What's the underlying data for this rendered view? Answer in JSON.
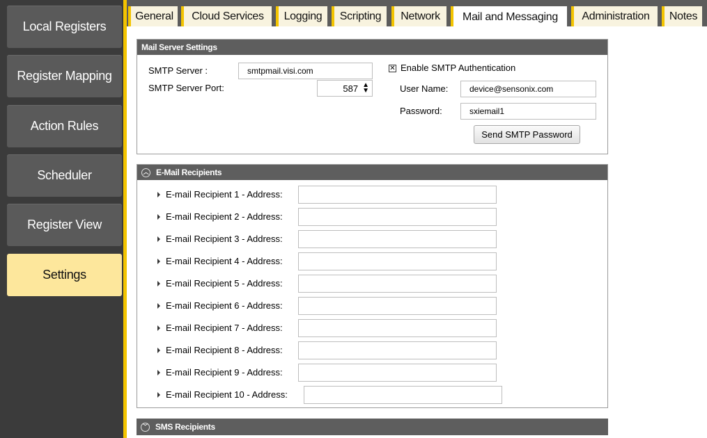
{
  "sidebar": {
    "items": [
      {
        "label": "Local Registers",
        "active": false
      },
      {
        "label": "Register Mapping",
        "active": false
      },
      {
        "label": "Action Rules",
        "active": false
      },
      {
        "label": "Scheduler",
        "active": false
      },
      {
        "label": "Register View",
        "active": false
      },
      {
        "label": "Settings",
        "active": true
      }
    ]
  },
  "tabs": [
    {
      "label": "General"
    },
    {
      "label": "Cloud Services"
    },
    {
      "label": "Logging"
    },
    {
      "label": "Scripting"
    },
    {
      "label": "Network"
    },
    {
      "label": "Mail and Messaging",
      "active": true
    },
    {
      "label": "Administration"
    },
    {
      "label": "Notes"
    }
  ],
  "mail_server": {
    "title": "Mail Server Settings",
    "smtp_server_label": "SMTP Server :",
    "smtp_server_value": "smtpmail.visi.com",
    "smtp_port_label": "SMTP Server Port:",
    "smtp_port_value": "587",
    "enable_auth_label": "Enable SMTP Authentication",
    "enable_auth_checked": "✕",
    "username_label": "User Name:",
    "username_value": "device@sensonix.com",
    "password_label": "Password:",
    "password_value": "sxiemail1",
    "send_button": "Send SMTP Password"
  },
  "email_recipients": {
    "title": "E-Mail Recipients",
    "items": [
      {
        "label": "E-mail Recipient 1  -  Address:",
        "value": ""
      },
      {
        "label": "E-mail Recipient 2  -  Address:",
        "value": ""
      },
      {
        "label": "E-mail Recipient 3  -  Address:",
        "value": ""
      },
      {
        "label": "E-mail Recipient 4  -  Address:",
        "value": ""
      },
      {
        "label": "E-mail Recipient 5  -  Address:",
        "value": ""
      },
      {
        "label": "E-mail Recipient 6  -  Address:",
        "value": ""
      },
      {
        "label": "E-mail Recipient 7  -  Address:",
        "value": ""
      },
      {
        "label": "E-mail Recipient 8  -  Address:",
        "value": ""
      },
      {
        "label": "E-mail Recipient 9  -  Address:",
        "value": ""
      },
      {
        "label": "E-mail Recipient 10  -  Address:",
        "value": ""
      }
    ]
  },
  "sms_recipients": {
    "title": "SMS Recipients"
  },
  "colors": {
    "sidebar_bg": "#3b3b3b",
    "nav_button": "#5a5a5a",
    "active_nav": "#fde79c",
    "accent_yellow": "#f3c400",
    "panel_header": "#5e5e5e"
  }
}
